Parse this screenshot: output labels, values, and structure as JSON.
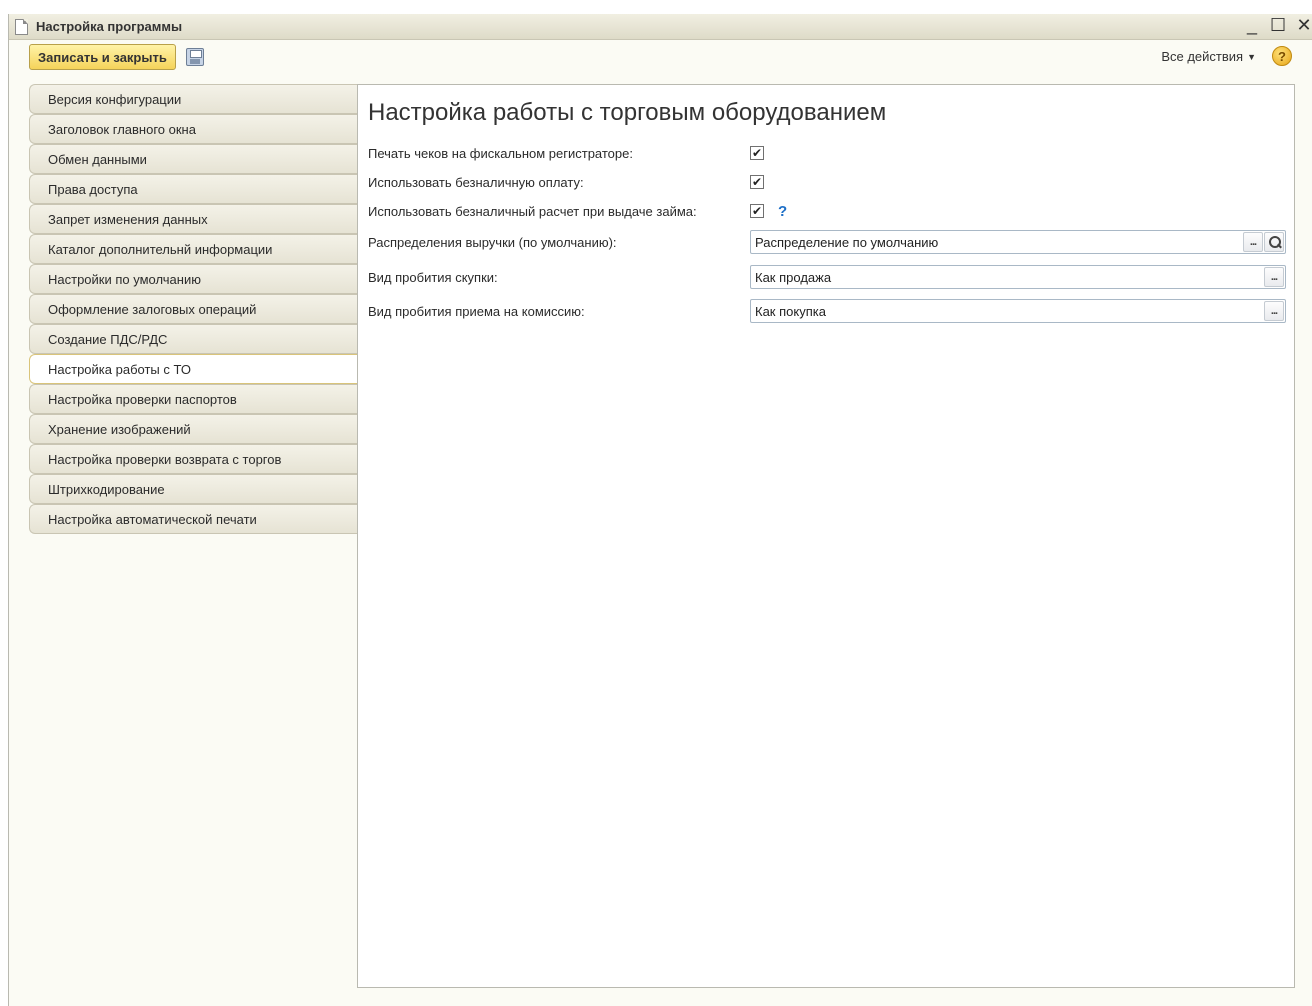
{
  "window": {
    "title": "Настройка программы",
    "controls": {
      "minimize": "_",
      "maximize": "☐",
      "close": "✕"
    }
  },
  "toolbar": {
    "save_close_label": "Записать и закрыть",
    "all_actions_label": "Все действия",
    "help_label": "?"
  },
  "sidebar": {
    "items": [
      {
        "label": "Версия конфигурации"
      },
      {
        "label": "Заголовок главного окна"
      },
      {
        "label": "Обмен данными"
      },
      {
        "label": "Права доступа"
      },
      {
        "label": "Запрет изменения данных"
      },
      {
        "label": "Каталог дополнительнй информации"
      },
      {
        "label": "Настройки по умолчанию"
      },
      {
        "label": "Оформление залоговых операций"
      },
      {
        "label": "Создание ПДС/РДС"
      },
      {
        "label": "Настройка работы с ТО"
      },
      {
        "label": "Настройка проверки паспортов"
      },
      {
        "label": "Хранение изображений"
      },
      {
        "label": "Настройка проверки возврата с торгов"
      },
      {
        "label": "Штрихкодирование"
      },
      {
        "label": "Настройка автоматической печати"
      }
    ],
    "active_index": 9
  },
  "main": {
    "title": "Настройка работы с торговым оборудованием",
    "checkboxes": [
      {
        "label": "Печать чеков на фискальном регистраторе:",
        "checked": true
      },
      {
        "label": "Использовать безналичную оплату:",
        "checked": true
      },
      {
        "label": "Использовать безналичный расчет при выдаче займа:",
        "checked": true,
        "hint": "?"
      }
    ],
    "fields": [
      {
        "label": "Распределения выручки (по умолчанию):",
        "value": "Распределение по умолчанию",
        "select_btn": "...",
        "search": true
      },
      {
        "label": "Вид пробития скупки:",
        "value": "Как продажа",
        "select_btn": "..."
      },
      {
        "label": "Вид пробития приема на комиссию:",
        "value": "Как покупка",
        "select_btn": "..."
      }
    ],
    "check_mark": "✔"
  }
}
